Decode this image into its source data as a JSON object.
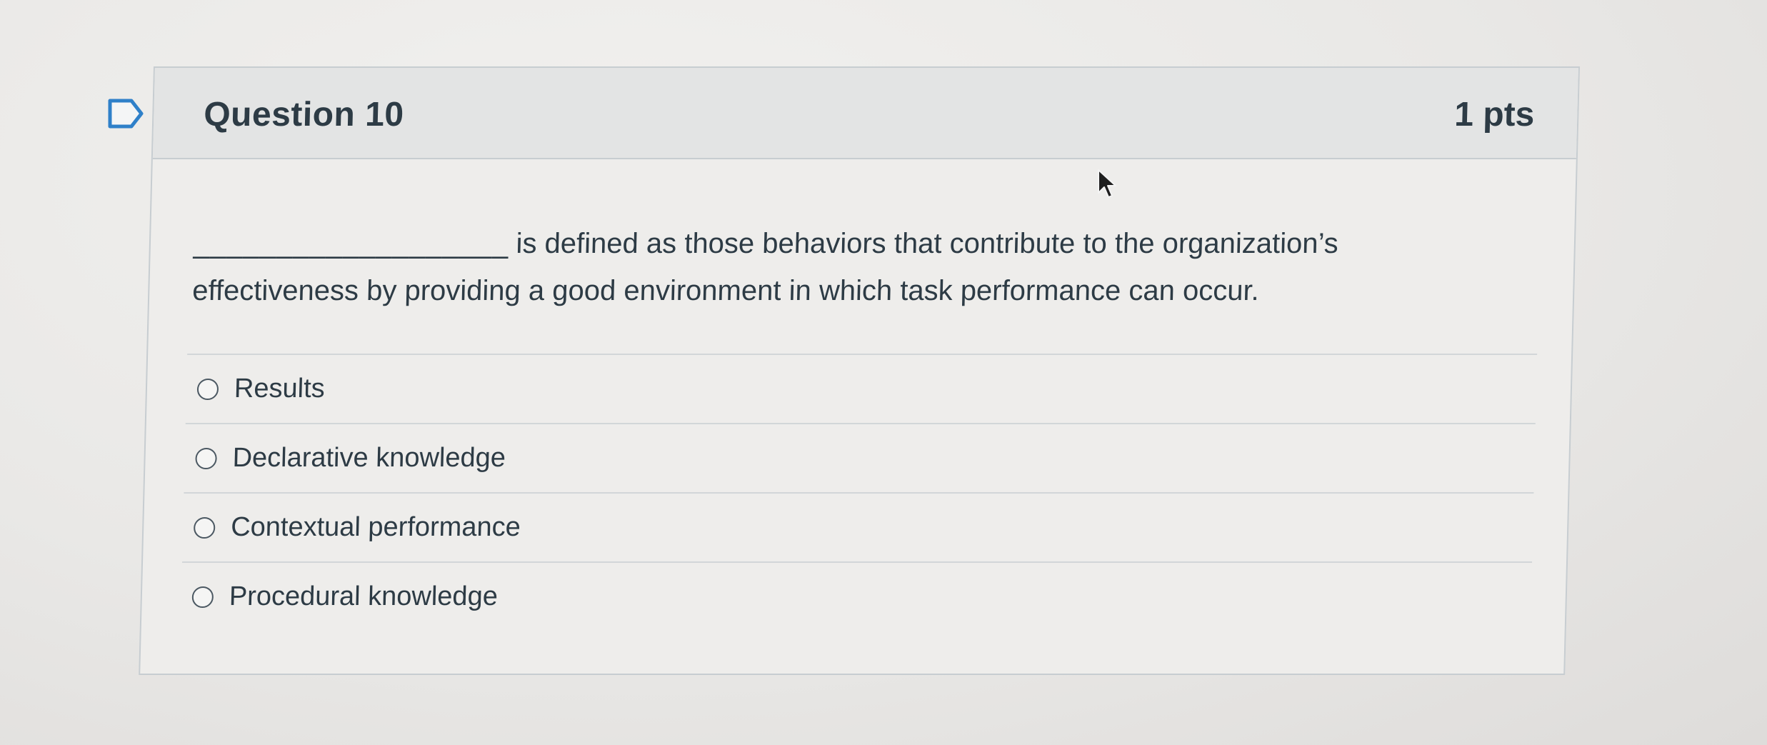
{
  "question": {
    "title": "Question 10",
    "points": "1 pts",
    "blank": "___________________",
    "text_line1": "is defined as those behaviors that contribute to the organization’s",
    "text_line2": "effectiveness by providing a good environment in which task performance can occur."
  },
  "answers": [
    {
      "label": "Results",
      "selected": false
    },
    {
      "label": "Declarative knowledge",
      "selected": false
    },
    {
      "label": "Contextual performance",
      "selected": false
    },
    {
      "label": "Procedural knowledge",
      "selected": false
    }
  ],
  "icons": {
    "flag": "flag-icon",
    "cursor": "mouse-pointer-icon"
  },
  "colors": {
    "text": "#2d3b45",
    "header_bg": "#e3e4e4",
    "border": "#c7cdd1",
    "flag_stroke": "#2f80c9"
  }
}
